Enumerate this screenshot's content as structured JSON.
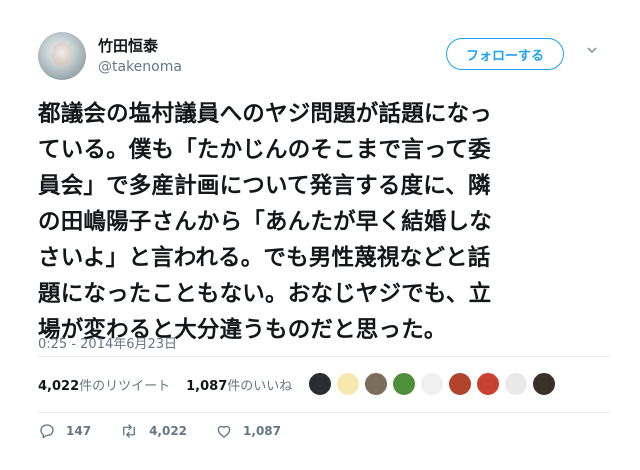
{
  "user": {
    "name": "竹田恒泰",
    "handle": "@takenoma"
  },
  "follow_label": "フォローする",
  "tweet_lines": [
    "都議会の塩村議員へのヤジ問題が話題になっ",
    "ている。僕も「たかじんのそこまで言って委",
    "員会」で多産計画について発言する度に、隣",
    "の田嶋陽子さんから「あんたが早く結婚しな",
    "さいよ」と言われる。でも男性蔑視などと話",
    "題になったこともない。おなじヤジでも、立",
    "場が変わると大分違うものだと思った。"
  ],
  "timestamp": "0:25 - 2014年6月23日",
  "stats": {
    "retweets_count": "4,022",
    "retweets_label": "件のリツイート",
    "likes_count": "1,087",
    "likes_label": "件のいいね"
  },
  "actions": {
    "replies": "147",
    "retweets": "4,022",
    "likes": "1,087"
  },
  "liker_colors": [
    "#2b2d33",
    "#f6e9b0",
    "#7b6d5b",
    "#4f8f3a",
    "#f0f0f0",
    "#b0452c",
    "#c8412e",
    "#e9e9e9",
    "#3a3128"
  ],
  "accent": "#1da1f2"
}
